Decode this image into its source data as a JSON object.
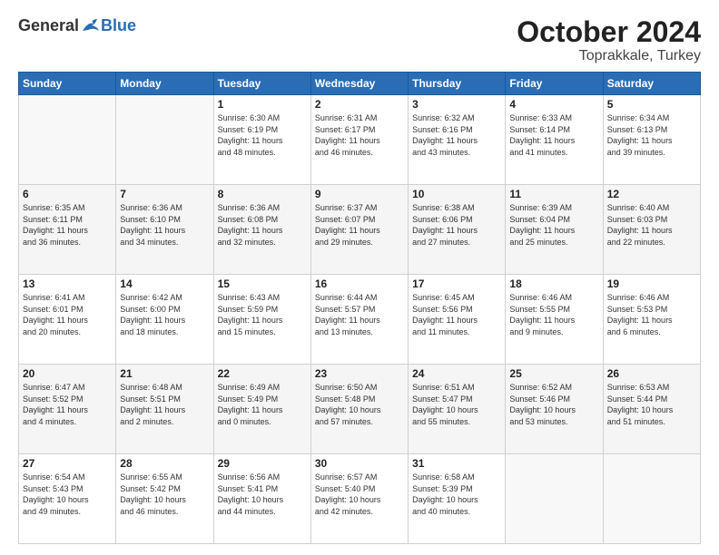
{
  "header": {
    "logo": {
      "general": "General",
      "blue": "Blue"
    },
    "title": "October 2024",
    "location": "Toprakkale, Turkey"
  },
  "columns": [
    "Sunday",
    "Monday",
    "Tuesday",
    "Wednesday",
    "Thursday",
    "Friday",
    "Saturday"
  ],
  "weeks": [
    {
      "shade": false,
      "days": [
        {
          "day": "",
          "info": ""
        },
        {
          "day": "",
          "info": ""
        },
        {
          "day": "1",
          "info": "Sunrise: 6:30 AM\nSunset: 6:19 PM\nDaylight: 11 hours\nand 48 minutes."
        },
        {
          "day": "2",
          "info": "Sunrise: 6:31 AM\nSunset: 6:17 PM\nDaylight: 11 hours\nand 46 minutes."
        },
        {
          "day": "3",
          "info": "Sunrise: 6:32 AM\nSunset: 6:16 PM\nDaylight: 11 hours\nand 43 minutes."
        },
        {
          "day": "4",
          "info": "Sunrise: 6:33 AM\nSunset: 6:14 PM\nDaylight: 11 hours\nand 41 minutes."
        },
        {
          "day": "5",
          "info": "Sunrise: 6:34 AM\nSunset: 6:13 PM\nDaylight: 11 hours\nand 39 minutes."
        }
      ]
    },
    {
      "shade": true,
      "days": [
        {
          "day": "6",
          "info": "Sunrise: 6:35 AM\nSunset: 6:11 PM\nDaylight: 11 hours\nand 36 minutes."
        },
        {
          "day": "7",
          "info": "Sunrise: 6:36 AM\nSunset: 6:10 PM\nDaylight: 11 hours\nand 34 minutes."
        },
        {
          "day": "8",
          "info": "Sunrise: 6:36 AM\nSunset: 6:08 PM\nDaylight: 11 hours\nand 32 minutes."
        },
        {
          "day": "9",
          "info": "Sunrise: 6:37 AM\nSunset: 6:07 PM\nDaylight: 11 hours\nand 29 minutes."
        },
        {
          "day": "10",
          "info": "Sunrise: 6:38 AM\nSunset: 6:06 PM\nDaylight: 11 hours\nand 27 minutes."
        },
        {
          "day": "11",
          "info": "Sunrise: 6:39 AM\nSunset: 6:04 PM\nDaylight: 11 hours\nand 25 minutes."
        },
        {
          "day": "12",
          "info": "Sunrise: 6:40 AM\nSunset: 6:03 PM\nDaylight: 11 hours\nand 22 minutes."
        }
      ]
    },
    {
      "shade": false,
      "days": [
        {
          "day": "13",
          "info": "Sunrise: 6:41 AM\nSunset: 6:01 PM\nDaylight: 11 hours\nand 20 minutes."
        },
        {
          "day": "14",
          "info": "Sunrise: 6:42 AM\nSunset: 6:00 PM\nDaylight: 11 hours\nand 18 minutes."
        },
        {
          "day": "15",
          "info": "Sunrise: 6:43 AM\nSunset: 5:59 PM\nDaylight: 11 hours\nand 15 minutes."
        },
        {
          "day": "16",
          "info": "Sunrise: 6:44 AM\nSunset: 5:57 PM\nDaylight: 11 hours\nand 13 minutes."
        },
        {
          "day": "17",
          "info": "Sunrise: 6:45 AM\nSunset: 5:56 PM\nDaylight: 11 hours\nand 11 minutes."
        },
        {
          "day": "18",
          "info": "Sunrise: 6:46 AM\nSunset: 5:55 PM\nDaylight: 11 hours\nand 9 minutes."
        },
        {
          "day": "19",
          "info": "Sunrise: 6:46 AM\nSunset: 5:53 PM\nDaylight: 11 hours\nand 6 minutes."
        }
      ]
    },
    {
      "shade": true,
      "days": [
        {
          "day": "20",
          "info": "Sunrise: 6:47 AM\nSunset: 5:52 PM\nDaylight: 11 hours\nand 4 minutes."
        },
        {
          "day": "21",
          "info": "Sunrise: 6:48 AM\nSunset: 5:51 PM\nDaylight: 11 hours\nand 2 minutes."
        },
        {
          "day": "22",
          "info": "Sunrise: 6:49 AM\nSunset: 5:49 PM\nDaylight: 11 hours\nand 0 minutes."
        },
        {
          "day": "23",
          "info": "Sunrise: 6:50 AM\nSunset: 5:48 PM\nDaylight: 10 hours\nand 57 minutes."
        },
        {
          "day": "24",
          "info": "Sunrise: 6:51 AM\nSunset: 5:47 PM\nDaylight: 10 hours\nand 55 minutes."
        },
        {
          "day": "25",
          "info": "Sunrise: 6:52 AM\nSunset: 5:46 PM\nDaylight: 10 hours\nand 53 minutes."
        },
        {
          "day": "26",
          "info": "Sunrise: 6:53 AM\nSunset: 5:44 PM\nDaylight: 10 hours\nand 51 minutes."
        }
      ]
    },
    {
      "shade": false,
      "days": [
        {
          "day": "27",
          "info": "Sunrise: 6:54 AM\nSunset: 5:43 PM\nDaylight: 10 hours\nand 49 minutes."
        },
        {
          "day": "28",
          "info": "Sunrise: 6:55 AM\nSunset: 5:42 PM\nDaylight: 10 hours\nand 46 minutes."
        },
        {
          "day": "29",
          "info": "Sunrise: 6:56 AM\nSunset: 5:41 PM\nDaylight: 10 hours\nand 44 minutes."
        },
        {
          "day": "30",
          "info": "Sunrise: 6:57 AM\nSunset: 5:40 PM\nDaylight: 10 hours\nand 42 minutes."
        },
        {
          "day": "31",
          "info": "Sunrise: 6:58 AM\nSunset: 5:39 PM\nDaylight: 10 hours\nand 40 minutes."
        },
        {
          "day": "",
          "info": ""
        },
        {
          "day": "",
          "info": ""
        }
      ]
    }
  ]
}
